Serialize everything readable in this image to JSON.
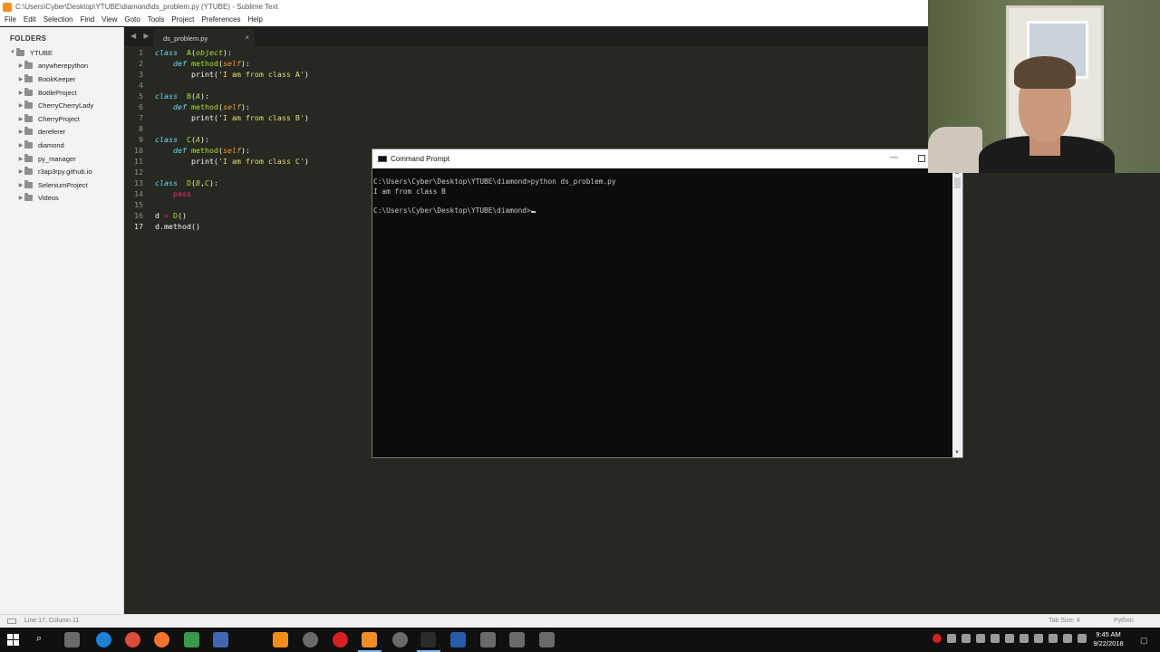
{
  "window": {
    "title": "C:\\Users\\Cyber\\Desktop\\YTUBE\\diamond\\ds_problem.py (YTUBE) - Sublime Text"
  },
  "menu": [
    "File",
    "Edit",
    "Selection",
    "Find",
    "View",
    "Goto",
    "Tools",
    "Project",
    "Preferences",
    "Help"
  ],
  "sidebar": {
    "title": "FOLDERS",
    "root": "YTUBE",
    "folders": [
      "anywherepython",
      "BookKeeper",
      "BottleProject",
      "CherryCherryLady",
      "CherryProject",
      "dereferer",
      "diamond",
      "py_manager",
      "r3ap3rpy.github.io",
      "SeleniumProject",
      "Videos"
    ]
  },
  "tab": {
    "label": "ds_problem.py",
    "close": "×",
    "nav": "◀ ▶"
  },
  "editor": {
    "line_numbers": [
      "1",
      "2",
      "3",
      "4",
      "5",
      "6",
      "7",
      "8",
      "9",
      "10",
      "11",
      "12",
      "13",
      "14",
      "15",
      "16",
      "17"
    ],
    "lines": [
      [
        [
          "kw",
          "class"
        ],
        [
          "",
          "  "
        ],
        [
          "fn",
          "A"
        ],
        [
          "",
          "("
        ],
        [
          "inh",
          "object"
        ],
        [
          "",
          "):"
        ]
      ],
      [
        [
          "",
          "    "
        ],
        [
          "kw",
          "def"
        ],
        [
          "",
          ""
        ],
        [
          "fn",
          " method"
        ],
        [
          "",
          "("
        ],
        [
          "slf",
          "self"
        ],
        [
          "",
          "):"
        ]
      ],
      [
        [
          "",
          "        print("
        ],
        [
          "str",
          "'I am from class A'"
        ],
        [
          "",
          ")"
        ]
      ],
      [],
      [
        [
          "kw",
          "class"
        ],
        [
          "",
          "  "
        ],
        [
          "fn",
          "B"
        ],
        [
          "",
          "("
        ],
        [
          "inh",
          "A"
        ],
        [
          "",
          "):"
        ]
      ],
      [
        [
          "",
          "    "
        ],
        [
          "kw",
          "def"
        ],
        [
          "fn",
          " method"
        ],
        [
          "",
          "("
        ],
        [
          "slf",
          "self"
        ],
        [
          "",
          "):"
        ]
      ],
      [
        [
          "",
          "        print("
        ],
        [
          "str",
          "'I am from class B'"
        ],
        [
          "",
          ")"
        ]
      ],
      [],
      [
        [
          "kw",
          "class"
        ],
        [
          "",
          "  "
        ],
        [
          "fn",
          "C"
        ],
        [
          "",
          "("
        ],
        [
          "inh",
          "A"
        ],
        [
          "",
          "):"
        ]
      ],
      [
        [
          "",
          "    "
        ],
        [
          "kw",
          "def"
        ],
        [
          "fn",
          " method"
        ],
        [
          "",
          "("
        ],
        [
          "slf",
          "self"
        ],
        [
          "",
          "):"
        ]
      ],
      [
        [
          "",
          "        print("
        ],
        [
          "str",
          "'I am from class C'"
        ],
        [
          "",
          ")"
        ]
      ],
      [],
      [
        [
          "kw",
          "class"
        ],
        [
          "",
          "  "
        ],
        [
          "fn",
          "D"
        ],
        [
          "",
          "("
        ],
        [
          "inh",
          "B"
        ],
        [
          "",
          ","
        ],
        [
          "inh",
          "C"
        ],
        [
          "",
          "):"
        ]
      ],
      [
        [
          "",
          "    "
        ],
        [
          "pss",
          "pass"
        ]
      ],
      [],
      [
        [
          "",
          "d "
        ],
        [
          "op",
          "="
        ],
        [
          "",
          ""
        ],
        [
          "fn",
          " D"
        ],
        [
          "",
          "()"
        ]
      ],
      [
        [
          "",
          "d.method()"
        ]
      ]
    ]
  },
  "statusbar": {
    "position": "Line 17, Column 11",
    "tab_size": "Tab Size: 4",
    "syntax": "Python"
  },
  "cmd": {
    "title": "Command Prompt",
    "lines": [
      "C:\\Users\\Cyber\\Desktop\\YTUBE\\diamond>python ds_problem.py",
      "I am from class B",
      "",
      "C:\\Users\\Cyber\\Desktop\\YTUBE\\diamond>"
    ]
  },
  "taskbar": {
    "time": "9:45 AM",
    "date": "9/22/2018",
    "apps": [
      "task-view",
      "edge",
      "chrome",
      "firefox",
      "green-app",
      "blue-app",
      "vlc",
      "app-circle",
      "red-record",
      "sublime",
      "app-globe",
      "cmd",
      "powershell",
      "db",
      "app-arc",
      "app-bird"
    ],
    "colors": {
      "edge": "#1e7fd6",
      "chrome": "#dd4b39",
      "firefox": "#f3722c",
      "green-app": "#3a9a4a",
      "blue-app": "#4267b2",
      "vlc": "#f28c1b",
      "sublime": "#f08d24",
      "cmd": "#2b2b2b",
      "powershell": "#2a5ba8",
      "red-record": "#d42020"
    }
  }
}
